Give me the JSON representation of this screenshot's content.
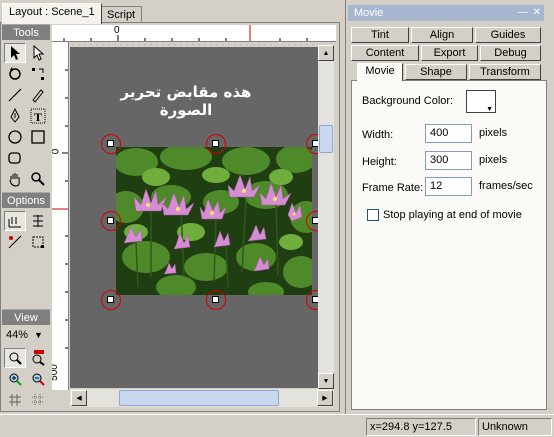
{
  "doc_tabs": [
    {
      "label": "Layout : Scene_1",
      "active": true
    },
    {
      "label": "Script",
      "active": false
    }
  ],
  "toolbox": {
    "tools_header": "Tools",
    "options_header": "Options",
    "view_header": "View",
    "zoom_value": "44%",
    "tools": [
      "arrow-select-icon",
      "subselect-arrow-icon",
      "transform-icon",
      "reshape-icon",
      "line-icon",
      "pencil-icon",
      "pen-icon",
      "text-icon",
      "ellipse-icon",
      "rectangle-icon",
      "rounded-rect-icon",
      "placeholder-icon",
      "hand-icon",
      "zoom-icon"
    ],
    "options": [
      "snap-to-grid-icon",
      "distort-icon",
      "envelope-icon",
      "free-transform-icon"
    ],
    "view": [
      "zoom-fit-icon",
      "zoom-100-icon",
      "zoom-in-icon",
      "zoom-out-icon",
      "show-grid-icon",
      "snap-icon"
    ]
  },
  "rulers": {
    "top_labels": [
      "0"
    ],
    "left_labels": [
      "0",
      "500"
    ]
  },
  "stage": {
    "title_text": "هذه مقابض تحرير الصورة",
    "background": "#666666"
  },
  "panel": {
    "title": "Movie",
    "tabs_row1": [
      "Tint",
      "Align",
      "Guides"
    ],
    "tabs_row2": [
      "Content",
      "Export",
      "Debug"
    ],
    "tabs_row3": [
      "Movie",
      "Shape",
      "Transform"
    ],
    "active_tab": "Movie",
    "background_color_label": "Background Color:",
    "background_color_value": "#ffffff",
    "width_label": "Width:",
    "width_value": "400",
    "width_unit": "pixels",
    "height_label": "Height:",
    "height_value": "300",
    "height_unit": "pixels",
    "frame_rate_label": "Frame Rate:",
    "frame_rate_value": "12",
    "frame_rate_unit": "frames/sec",
    "stop_playing_label": "Stop playing at end of movie",
    "stop_playing_checked": false
  },
  "status": {
    "coords": "x=294.8 y=127.5",
    "size": "Unknown Size"
  },
  "colors": {
    "handle_ring": "#d40000",
    "panel_title_bg": "#a6b6cf",
    "stage_bg": "#666666"
  }
}
